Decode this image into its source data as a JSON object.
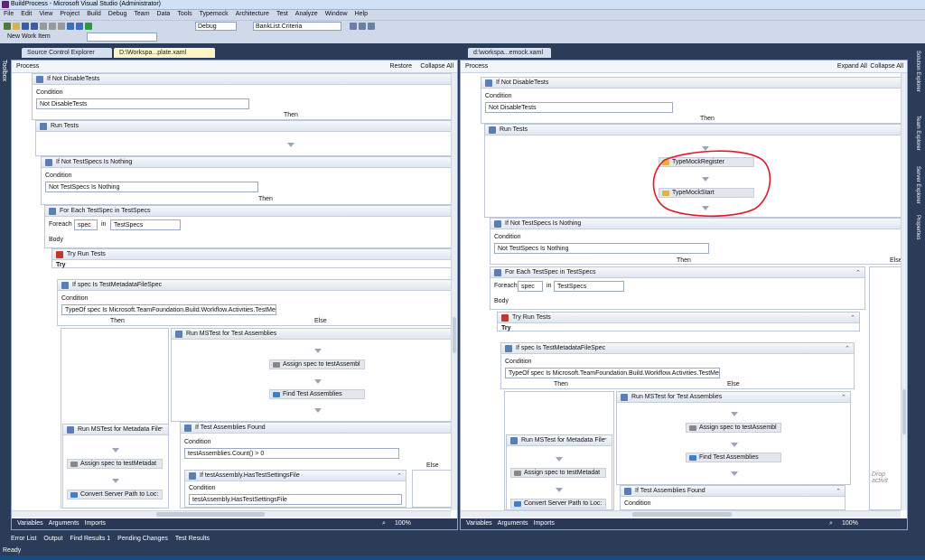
{
  "window": {
    "title": "BuildProcess - Microsoft Visual Studio (Administrator)"
  },
  "menu": [
    "File",
    "Edit",
    "View",
    "Project",
    "Build",
    "Debug",
    "Team",
    "Data",
    "Tools",
    "Typemock",
    "Architecture",
    "Test",
    "Analyze",
    "Window",
    "Help"
  ],
  "toolbar": {
    "new_work_item": "New Work Item",
    "config": "Debug",
    "find": "BankList.Criteria"
  },
  "left_tabs": {
    "tab1": "Source Control Explorer",
    "tab2": "D:\\Workspa...plate.xaml"
  },
  "right_tabs": {
    "tab1": "d:\\workspa...emock.xaml"
  },
  "toolbox": "Toolbox",
  "left": {
    "process": "Process",
    "restore": "Restore",
    "collapse_all": "Collapse All",
    "if_not_disable": "If Not DisableTests",
    "condition": "Condition",
    "cond_val": "Not DisableTests",
    "then": "Then",
    "run_tests": "Run Tests",
    "if_not_testspecs": "If Not TestSpecs Is Nothing",
    "cond2_val": "Not TestSpecs Is Nothing",
    "then2": "Then",
    "foreach": "For Each TestSpec in TestSpecs",
    "foreach_lbl": "Foreach",
    "spec": "spec",
    "in": "in",
    "testspecs": "TestSpecs",
    "body": "Body",
    "try_run": "Try Run Tests",
    "try": "Try",
    "if_spec": "If spec Is TestMetadataFileSpec",
    "cond3_val": "TypeOf spec Is Microsoft.TeamFoundation.Build.Workflow.Activities.TestMetadatal",
    "then3": "Then",
    "else3": "Else",
    "run_mstest": "Run MSTest for Test Assemblies",
    "assign": "Assign spec to testAssembl",
    "find": "Find Test Assemblies",
    "run_mstest_meta": "Run MSTest for Metadata File",
    "assign_meta": "Assign spec to testMetadat",
    "convert": "Convert Server Path to Loc:",
    "if_found": "If Test Assemblies Found",
    "cond4_val": "testAssemblies.Count() > 0",
    "else4": "Else",
    "if_settings": "If testAssembly.HasTestSettingsFile",
    "cond5_val": "testAssembly.HasTestSettingsFile",
    "zoom": "100%",
    "variables": "Variables",
    "arguments": "Arguments",
    "imports": "Imports"
  },
  "right": {
    "process": "Process",
    "expand_all": "Expand All",
    "collapse_all": "Collapse All",
    "if_not_disable": "If Not DisableTests",
    "condition": "Condition",
    "cond_val": "Not DisableTests",
    "then": "Then",
    "run_tests": "Run Tests",
    "typemock_register": "TypeMockRegister",
    "typemock_start": "TypeMockStart",
    "if_not_testspecs": "If Not TestSpecs Is Nothing",
    "cond2_val": "Not TestSpecs Is Nothing",
    "then2": "Then",
    "else2": "Else",
    "foreach": "For Each TestSpec in TestSpecs",
    "foreach_lbl": "Foreach",
    "spec": "spec",
    "in": "in",
    "testspecs": "TestSpecs",
    "body": "Body",
    "try_run": "Try Run Tests",
    "try": "Try",
    "if_spec": "If spec Is TestMetadataFileSpec",
    "cond3_val": "TypeOf spec Is Microsoft.TeamFoundation.Build.Workflow.Activities.TestMetadatal",
    "then3": "Then",
    "else3": "Else",
    "run_mstest": "Run MSTest for Test Assemblies",
    "assign": "Assign spec to testAssembl",
    "find": "Find Test Assemblies",
    "run_mstest_meta": "Run MSTest for Metadata File",
    "assign_meta": "Assign spec to testMetadat",
    "convert": "Convert Server Path to Loc:",
    "if_found": "If Test Assemblies Found",
    "drop": "Drop activit",
    "zoom": "100%",
    "variables": "Variables",
    "arguments": "Arguments",
    "imports": "Imports"
  },
  "right_dock": [
    "Solution Explorer",
    "Team Explorer",
    "Server Explorer",
    "Properties"
  ],
  "output_tabs": [
    "Error List",
    "Output",
    "Find Results 1",
    "Pending Changes",
    "Test Results"
  ],
  "status": "Ready",
  "colors": {
    "accent": "#2b3c59",
    "annotation": "#e0192a"
  }
}
